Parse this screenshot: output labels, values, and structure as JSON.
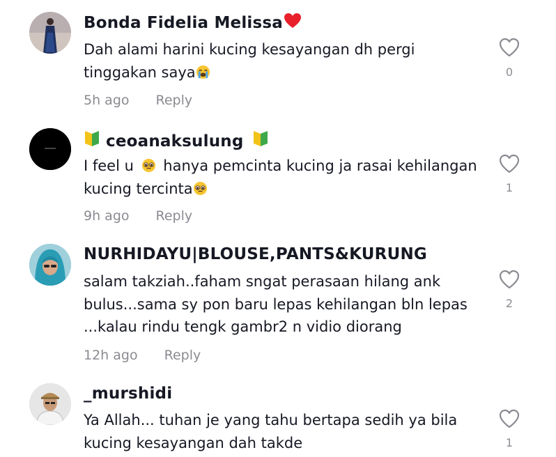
{
  "comments": [
    {
      "username": "Bonda Fidelia Melissa",
      "username_suffix_icon": "red-heart-emoji",
      "text_parts": [
        "Dah alami harini kucing kesayangan dh pergi tinggakan saya"
      ],
      "text_emoji": "loudly-crying-face-emoji",
      "time": "5h ago",
      "reply_label": "Reply",
      "like_count": "0",
      "avatar_desc": "woman-in-dark-dress"
    },
    {
      "username": "ceoanaksulung",
      "username_badge_icon": "japanese-beginner-symbol-emoji",
      "text_a": "I feel u",
      "text_b": "hanya pemcinta kucing ja rasai kehilangan kucing tercinta",
      "text_emoji": "pleading-face-emoji",
      "time": "9h ago",
      "reply_label": "Reply",
      "like_count": "1",
      "avatar_desc": "black-circle-logo"
    },
    {
      "username": "NURHIDAYU|BLOUSE,PANTS&KURUNG",
      "text": "salam takziah..faham sngat perasaan hilang ank bulus...sama sy pon baru lepas kehilangan bln lepas ...kalau rindu tengk gambr2 n vidio diorang",
      "time": "12h ago",
      "reply_label": "Reply",
      "like_count": "2",
      "avatar_desc": "woman-in-teal-hijab"
    },
    {
      "username": "_murshidi",
      "text": "Ya Allah... tuhan je yang tahu bertapa sedih ya bila kucing kesayangan dah takde",
      "like_count": "1",
      "avatar_desc": "man-with-cap"
    }
  ],
  "colors": {
    "primary_text": "#161823",
    "secondary_text": "#8a8b91",
    "like_outline": "#8a8b91",
    "heart_red": "#e8202b"
  }
}
